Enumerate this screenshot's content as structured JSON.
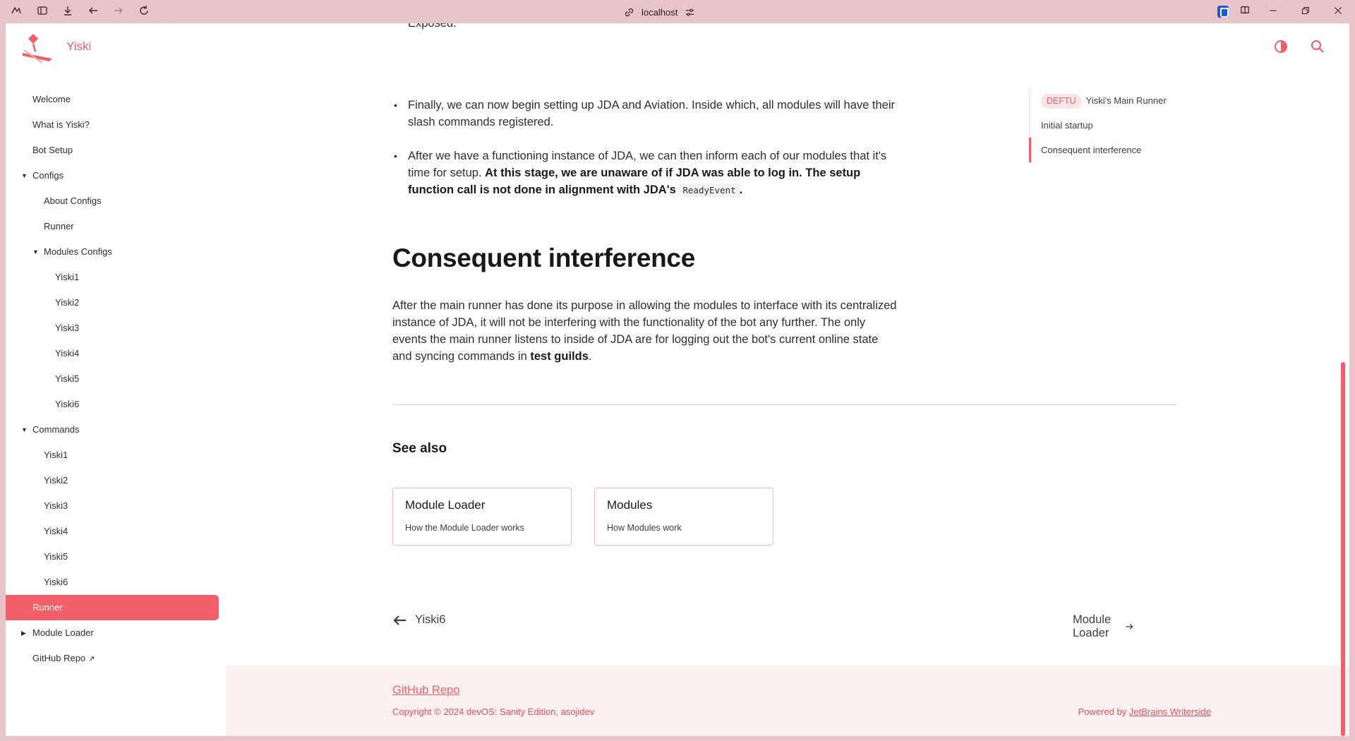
{
  "browser": {
    "url": "localhost"
  },
  "brand": {
    "name": "Yiski",
    "color": "#f25c66"
  },
  "sidebar": {
    "items": [
      {
        "label": "Welcome"
      },
      {
        "label": "What is Yiski?"
      },
      {
        "label": "Bot Setup"
      },
      {
        "label": "Configs"
      },
      {
        "label": "About Configs"
      },
      {
        "label": "Runner"
      },
      {
        "label": "Modules Configs"
      },
      {
        "label": "Yiski1"
      },
      {
        "label": "Yiski2"
      },
      {
        "label": "Yiski3"
      },
      {
        "label": "Yiski4"
      },
      {
        "label": "Yiski5"
      },
      {
        "label": "Yiski6"
      },
      {
        "label": "Commands"
      },
      {
        "label": "Yiski1"
      },
      {
        "label": "Yiski2"
      },
      {
        "label": "Yiski3"
      },
      {
        "label": "Yiski4"
      },
      {
        "label": "Yiski5"
      },
      {
        "label": "Yiski6"
      },
      {
        "label": "Runner"
      },
      {
        "label": "Module Loader"
      },
      {
        "label": "GitHub Repo"
      }
    ]
  },
  "article": {
    "cut_text": "Exposed.",
    "bullet1": "Finally, we can now begin setting up JDA and Aviation. Inside which, all modules will have their slash commands registered.",
    "bullet2_plain": "After we have a functioning instance of JDA, we can then inform each of our modules that it's time for setup.",
    "bullet2_bold": "At this stage, we are unaware of if JDA was able to log in. The setup function call is not done in alignment with JDA's",
    "bullet2_code": "ReadyEvent",
    "bullet2_end": ".",
    "heading": "Consequent interference",
    "para_plain": "After the main runner has done its purpose in allowing the modules to interface with its centralized instance of JDA, it will not be interfering with the functionality of the bot any further. The only events the main runner listens to inside of JDA are for logging out the bot's current online state and syncing commands in",
    "para_bold": "test guilds",
    "para_end": ".",
    "see_also": "See also",
    "cards": [
      {
        "title": "Module Loader",
        "desc": "How the Module Loader works"
      },
      {
        "title": "Modules",
        "desc": "How Modules work"
      }
    ],
    "prev": "Yiski6",
    "next": "Module Loader"
  },
  "toc": {
    "badge": "DEFTU",
    "item1": "Yiski's Main Runner",
    "item2": "Initial startup",
    "item3": "Consequent interference"
  },
  "footer": {
    "link": "GitHub Repo",
    "copyright": "Copyright © 2024 devOS: Sanity Edition, asojidev",
    "powered_prefix": "Powered by",
    "powered_link": "JetBrains Writerside"
  }
}
